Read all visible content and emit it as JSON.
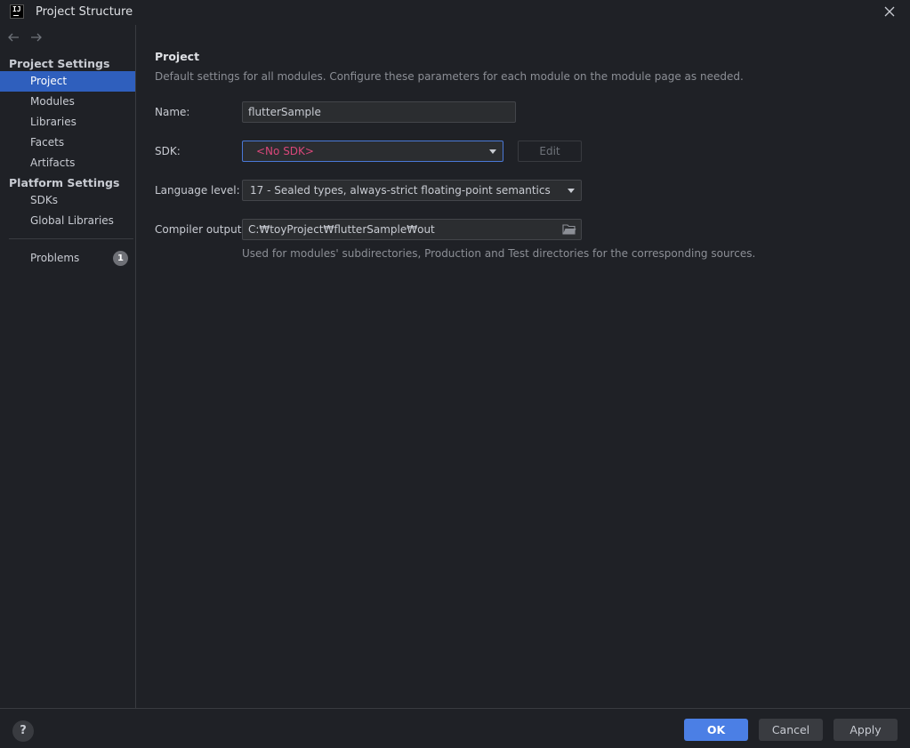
{
  "window": {
    "title": "Project Structure",
    "logo_text": "IJ"
  },
  "sidebar": {
    "project_settings_header": "Project Settings",
    "project_settings_items": [
      {
        "label": "Project",
        "selected": true
      },
      {
        "label": "Modules"
      },
      {
        "label": "Libraries"
      },
      {
        "label": "Facets"
      },
      {
        "label": "Artifacts"
      }
    ],
    "platform_settings_header": "Platform Settings",
    "platform_settings_items": [
      {
        "label": "SDKs"
      },
      {
        "label": "Global Libraries"
      }
    ],
    "problems": {
      "label": "Problems",
      "count": "1"
    }
  },
  "main": {
    "title": "Project",
    "description": "Default settings for all modules. Configure these parameters for each module on the module page as needed.",
    "name": {
      "label": "Name:",
      "value": "flutterSample"
    },
    "sdk": {
      "label": "SDK:",
      "value": "<No SDK>",
      "edit_label": "Edit"
    },
    "language_level": {
      "label": "Language level:",
      "value": "17 - Sealed types, always-strict floating-point semantics"
    },
    "compiler_output": {
      "label": "Compiler output:",
      "value": "C:₩toyProject₩flutterSample₩out",
      "hint": "Used for modules' subdirectories, Production and Test directories for the corresponding sources."
    }
  },
  "footer": {
    "help_label": "?",
    "ok_label": "OK",
    "cancel_label": "Cancel",
    "apply_label": "Apply"
  },
  "colors": {
    "background": "#1f2126",
    "selection": "#2f5fbd",
    "primary_button": "#4b7fe5",
    "error_text": "#d9477a"
  }
}
